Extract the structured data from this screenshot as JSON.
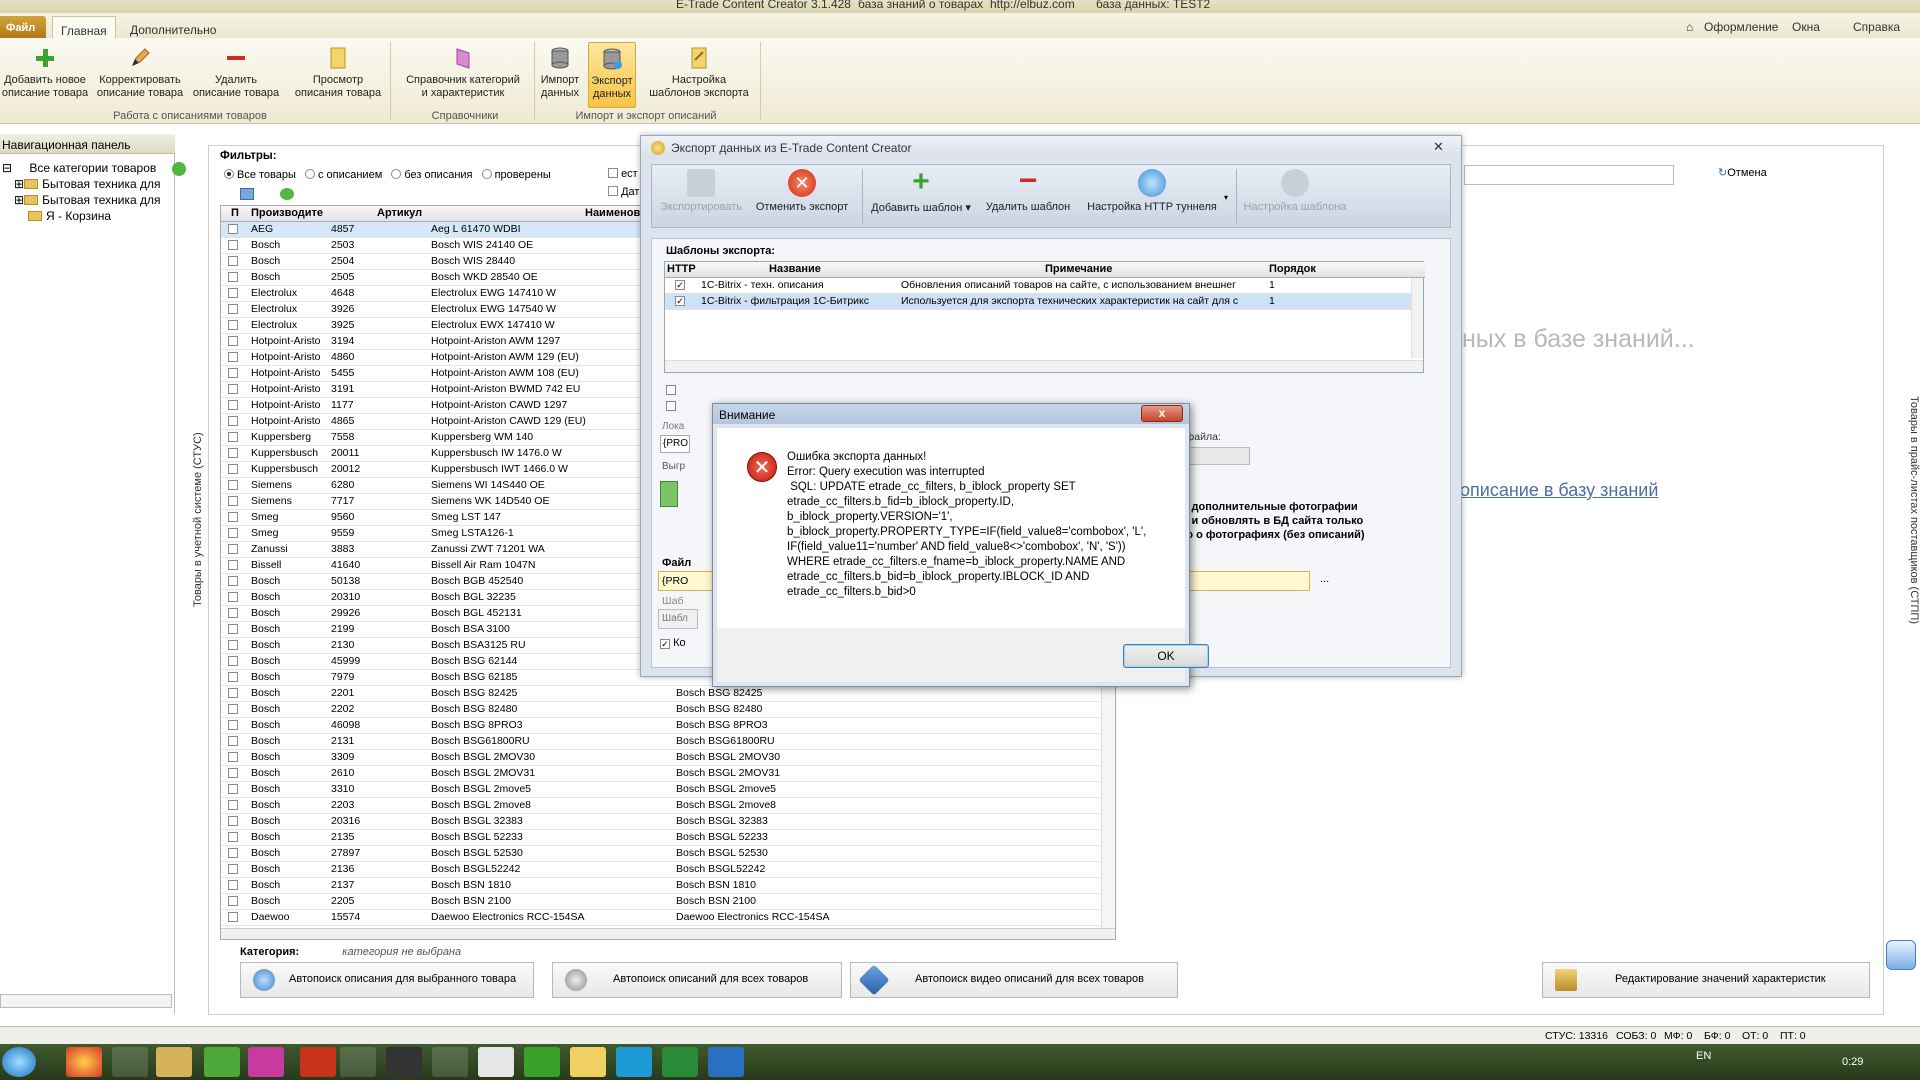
{
  "window": {
    "title": "E-Trade Content Creator 3.1.428",
    "kb_label": "база знаний о товарах",
    "site": "http://elbuz.com",
    "db_label": "база данных: TEST2"
  },
  "tabs": {
    "file": "Файл",
    "main": "Главная",
    "extra": "Дополнительно"
  },
  "topright": {
    "design": "Оформление",
    "windows": "Окна",
    "help": "Справка"
  },
  "ribbon": {
    "btn_add": "Добавить новое описание товара",
    "btn_add_l1": "Добавить новое",
    "btn_add_l2": "описание товара",
    "btn_edit_l1": "Корректировать",
    "btn_edit_l2": "описание товара",
    "btn_del_l1": "Удалить",
    "btn_del_l2": "описание товара",
    "btn_view_l1": "Просмотр",
    "btn_view_l2": "описания товара",
    "btn_dict_l1": "Справочник категорий",
    "btn_dict_l2": "и характеристик",
    "btn_import_l1": "Импорт",
    "btn_import_l2": "данных",
    "btn_export_l1": "Экспорт",
    "btn_export_l2": "данных",
    "btn_tpl_l1": "Настройка",
    "btn_tpl_l2": "шаблонов экспорта",
    "group1": "Работа с описаниями товаров",
    "group2": "Справочники",
    "group3": "Импорт и экспорт описаний"
  },
  "nav": {
    "header": "Навигационная панель",
    "items": [
      "Все категории товаров",
      "Бытовая техника для",
      "Бытовая техника для",
      "Я - Корзина"
    ]
  },
  "side_vertical": "Товары в учетной системе (СТУС)",
  "right_vertical": "Товары в прайс-листах поставщиков (СТПП)",
  "filters": {
    "label": "Фильтры:",
    "opt_all": "Все товары",
    "opt_with": "с описанием",
    "opt_without": "без описания",
    "opt_checked": "проверены",
    "cb1": "ест",
    "cb2": "Дат"
  },
  "grid": {
    "headers": [
      "П",
      "Производите",
      "Артикул",
      "Наименов"
    ],
    "rows": [
      [
        "AEG",
        "4857",
        "Aeg L 61470 WDBI",
        ""
      ],
      [
        "Bosch",
        "2503",
        "Bosch WIS 24140 OE",
        ""
      ],
      [
        "Bosch",
        "2504",
        "Bosch WIS 28440",
        ""
      ],
      [
        "Bosch",
        "2505",
        "Bosch WKD 28540 OE",
        ""
      ],
      [
        "Electrolux",
        "4648",
        "Electrolux EWG 147410 W",
        ""
      ],
      [
        "Electrolux",
        "3926",
        "Electrolux EWG 147540 W",
        ""
      ],
      [
        "Electrolux",
        "3925",
        "Electrolux EWX 147410 W",
        ""
      ],
      [
        "Hotpoint-Aristo",
        "3194",
        "Hotpoint-Ariston AWM 1297",
        ""
      ],
      [
        "Hotpoint-Aristo",
        "4860",
        "Hotpoint-Ariston AWM 129 (EU)",
        ""
      ],
      [
        "Hotpoint-Aristo",
        "5455",
        "Hotpoint-Ariston AWM 108 (EU)",
        ""
      ],
      [
        "Hotpoint-Aristo",
        "3191",
        "Hotpoint-Ariston BWMD 742 EU",
        ""
      ],
      [
        "Hotpoint-Aristo",
        "1177",
        "Hotpoint-Ariston CAWD 1297",
        ""
      ],
      [
        "Hotpoint-Aristo",
        "4865",
        "Hotpoint-Ariston CAWD 129 (EU)",
        ""
      ],
      [
        "Kuppersberg",
        "7558",
        "Kuppersberg WM 140",
        ""
      ],
      [
        "Kuppersbusch",
        "20011",
        "Kuppersbusch IW 1476.0 W",
        ""
      ],
      [
        "Kuppersbusch",
        "20012",
        "Kuppersbusch IWT 1466.0 W",
        ""
      ],
      [
        "Siemens",
        "6280",
        "Siemens WI 14S440 OE",
        ""
      ],
      [
        "Siemens",
        "7717",
        "Siemens WK 14D540 OE",
        ""
      ],
      [
        "Smeg",
        "9560",
        "Smeg LST 147",
        ""
      ],
      [
        "Smeg",
        "9559",
        "Smeg LSTA126-1",
        ""
      ],
      [
        "Zanussi",
        "3883",
        "Zanussi ZWT 71201 WA",
        ""
      ],
      [
        "Bissell",
        "41640",
        "Bissell Air Ram 1047N",
        ""
      ],
      [
        "Bosch",
        "50138",
        "Bosch BGB 452540",
        ""
      ],
      [
        "Bosch",
        "20310",
        "Bosch BGL 32235",
        ""
      ],
      [
        "Bosch",
        "29926",
        "Bosch BGL 452131",
        ""
      ],
      [
        "Bosch",
        "2199",
        "Bosch BSA 3100",
        ""
      ],
      [
        "Bosch",
        "2130",
        "Bosch BSA3125 RU",
        ""
      ],
      [
        "Bosch",
        "45999",
        "Bosch BSG 62144",
        ""
      ],
      [
        "Bosch",
        "7979",
        "Bosch BSG 62185",
        ""
      ],
      [
        "Bosch",
        "2201",
        "Bosch BSG 82425",
        "Bosch BSG 82425"
      ],
      [
        "Bosch",
        "2202",
        "Bosch BSG 82480",
        "Bosch BSG 82480"
      ],
      [
        "Bosch",
        "46098",
        "Bosch BSG 8PRO3",
        "Bosch BSG 8PRO3"
      ],
      [
        "Bosch",
        "2131",
        "Bosch BSG61800RU",
        "Bosch BSG61800RU"
      ],
      [
        "Bosch",
        "3309",
        "Bosch BSGL 2MOV30",
        "Bosch BSGL 2MOV30"
      ],
      [
        "Bosch",
        "2610",
        "Bosch BSGL 2MOV31",
        "Bosch BSGL 2MOV31"
      ],
      [
        "Bosch",
        "3310",
        "Bosch BSGL 2move5",
        "Bosch BSGL 2move5"
      ],
      [
        "Bosch",
        "2203",
        "Bosch BSGL 2move8",
        "Bosch BSGL 2move8"
      ],
      [
        "Bosch",
        "20316",
        "Bosch BSGL 32383",
        "Bosch BSGL 32383"
      ],
      [
        "Bosch",
        "2135",
        "Bosch BSGL 52233",
        "Bosch BSGL 52233"
      ],
      [
        "Bosch",
        "27897",
        "Bosch BSGL 52530",
        "Bosch BSGL 52530"
      ],
      [
        "Bosch",
        "2136",
        "Bosch BSGL52242",
        "Bosch BSGL52242"
      ],
      [
        "Bosch",
        "2137",
        "Bosch BSN 1810",
        "Bosch BSN 1810"
      ],
      [
        "Bosch",
        "2205",
        "Bosch BSN 2100",
        "Bosch BSN 2100"
      ],
      [
        "Daewoo",
        "15574",
        "Daewoo Electronics RCC-154SA",
        "Daewoo Electronics RCC-154SA"
      ]
    ]
  },
  "category": {
    "label": "Категория:",
    "value": "категория не выбрана"
  },
  "bottom_buttons": {
    "b1": "Автопоиск описания для выбранного товара",
    "b2": "Автопоиск описаний для всех товаров",
    "b3": "Автопоиск видео описаний для всех товаров",
    "b4": "Редактирование значений характеристик"
  },
  "background_right": {
    "cancel": "Отмена",
    "big_text": "ных в базе знаний...",
    "link_text": "описание в базу знаний"
  },
  "export_window": {
    "title": "Экспорт данных из E-Trade Content Creator",
    "btn_export": "Экспортировать",
    "btn_cancel": "Отменить экспорт",
    "btn_add_tpl": "Добавить шаблон",
    "btn_del_tpl": "Удалить шаблон",
    "btn_http": "Настройка HTTP туннеля",
    "btn_tpl_settings": "Настройка шаблона",
    "section": "Шаблоны экспорта:",
    "tpl_headers": [
      "HTTP",
      "Название",
      "Примечание",
      "Порядок"
    ],
    "tpl_rows": [
      [
        "1C-Bitrix - техн. описания",
        "Обновления описаний товаров на сайте, с использованием внешнег",
        "1"
      ],
      [
        "1C-Bitrix - фильтрация 1C-Битрикс",
        "Используется для экспорта технических характеристик на сайт для с",
        "1"
      ]
    ],
    "file_name_label": "мени файла:",
    "photo_line1": "ужать дополнительные фотографии",
    "photo_line2": "ужать и обновлять в БД сайта только",
    "photo_line3": "мацию о фотографиях (без описаний)",
    "file_label": "Файл",
    "file_value": "{PRO",
    "tpl_label": "Шаб",
    "tpl_value": "Шабл",
    "local_label": "Лока",
    "local_value": "{PRO",
    "unload_label": "Выгр",
    "ko_label": "Ко",
    "dots": "..."
  },
  "alert": {
    "title": "Внимание",
    "message": "Ошибка экспорта данных!\nError: Query execution was interrupted\n SQL: UPDATE etrade_cc_filters, b_iblock_property SET\netrade_cc_filters.b_fid=b_iblock_property.ID,\nb_iblock_property.VERSION='1',\nb_iblock_property.PROPERTY_TYPE=IF(field_value8='combobox', 'L',\nIF(field_value11='number' AND field_value8<>'combobox', 'N', 'S'))\nWHERE etrade_cc_filters.e_fname=b_iblock_property.NAME AND\netrade_cc_filters.b_bid=b_iblock_property.IBLOCK_ID AND\netrade_cc_filters.b_bid>0",
    "ok": "OK",
    "close": "x"
  },
  "status": {
    "s1": "СТУС: 13316",
    "s2": "СОБЗ: 0",
    "s3": "МФ: 0",
    "s4": "БФ: 0",
    "s5": "ОТ: 0",
    "s6": "ПТ: 0"
  },
  "taskbar": {
    "lang": "EN",
    "time": "0:29"
  }
}
